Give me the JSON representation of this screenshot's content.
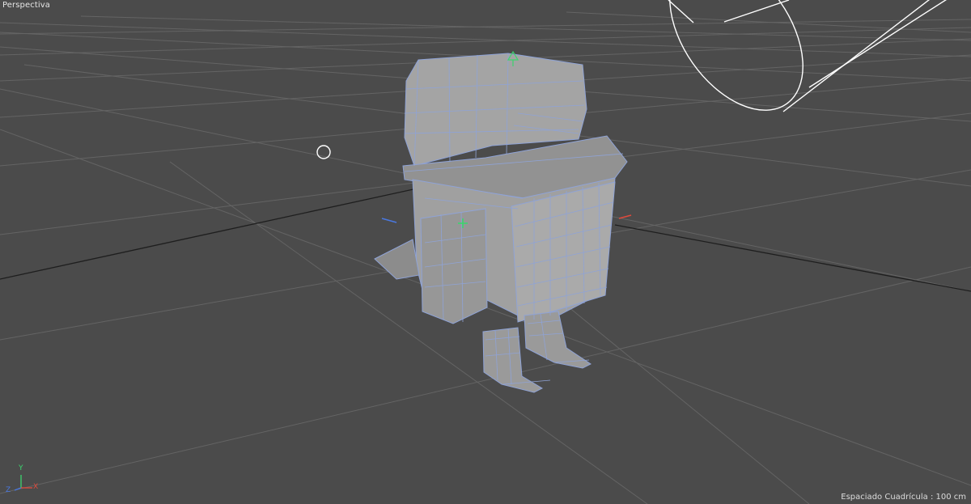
{
  "viewport": {
    "view_name": "Perspectiva",
    "grid_spacing": "Espaciado Cuadrícula : 100 cm",
    "axes": {
      "x": "X",
      "y": "Y",
      "z": "Z"
    }
  },
  "colors": {
    "background": "#4b4b4b",
    "grid_line": "#6a6a6a",
    "wireframe": "#8fa3d6",
    "selection_fill": "#a6a6a6",
    "camera_lines": "#ffffff",
    "axis_x": "#e04a3c",
    "axis_y": "#3cd46e",
    "axis_z": "#4a78e0"
  }
}
